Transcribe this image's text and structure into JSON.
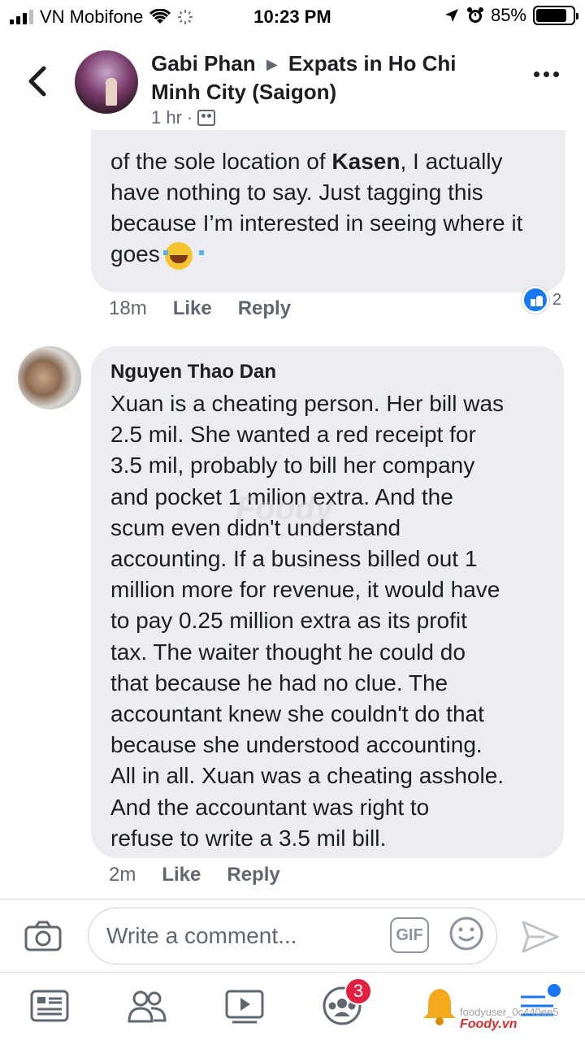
{
  "status_bar": {
    "carrier": "VN Mobifone",
    "time": "10:23 PM",
    "battery": "85%"
  },
  "header": {
    "poster": "Gabi Phan",
    "group": "Expats in Ho Chi Minh City (Saigon)",
    "time": "1 hr",
    "separator": "·"
  },
  "comment1": {
    "text_prefix": "of the sole location of ",
    "text_bold": "Kasen",
    "text_suffix": ", I actually have nothing to say. Just tagging this because I’m interested in seeing where it goes",
    "emoji": "laughing-tears-emoji",
    "time": "18m",
    "like_label": "Like",
    "reply_label": "Reply",
    "reaction_count": "2"
  },
  "comment2": {
    "author": "Nguyen Thao Dan",
    "text": "Xuan is a cheating person. Her bill was\n2.5 mil. She wanted a red receipt for\n3.5 mil, probably to bill her company\nand pocket 1 milion extra. And the\nscum even didn't understand\naccounting. If a business billed out  1\nmillion more for revenue, it would have\nto pay 0.25 million extra as its profit\ntax. The waiter thought he could do\nthat because he had no clue. The\naccountant knew she couldn't do that\nbecause she understood accounting.\nAll in all. Xuan was a cheating asshole.\nAnd the accountant was right to\nrefuse to write a 3.5 mil bill.",
    "time": "2m",
    "like_label": "Like",
    "reply_label": "Reply"
  },
  "composer": {
    "placeholder": "Write a comment...",
    "gif_label": "GIF"
  },
  "bottom_nav": {
    "groups_badge": "3"
  },
  "watermarks": {
    "center": "Foody",
    "footer_user": "foodyuser_0c440ee5",
    "footer_logo": "Foody.vn"
  },
  "colors": {
    "accent": "#1877f2",
    "bubble": "#ebedf0",
    "badge": "#e41e3f"
  }
}
